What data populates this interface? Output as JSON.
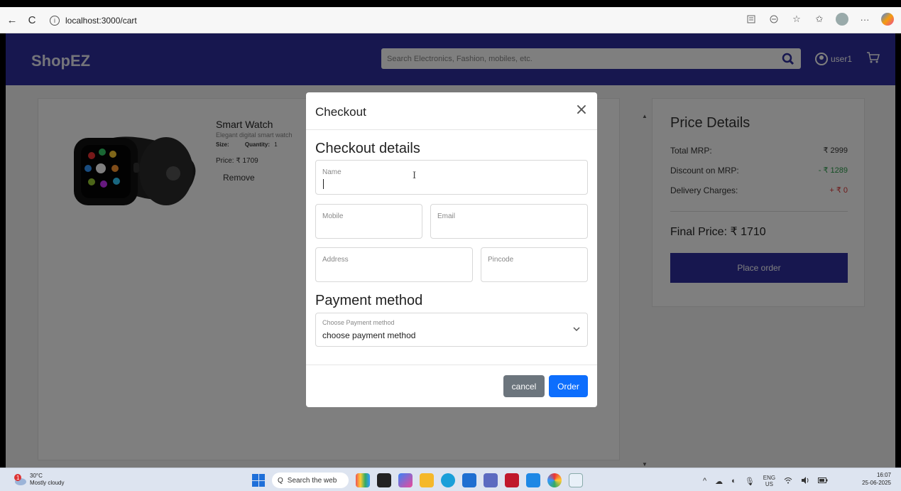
{
  "browser": {
    "url": "localhost:3000/cart",
    "back_glyph": "←",
    "reload_glyph": "C",
    "info_glyph": "i"
  },
  "header": {
    "brand": "ShopEZ",
    "search_placeholder": "Search Electronics, Fashion, mobiles, etc.",
    "user_label": "user1",
    "accent_color": "#2f2f9e"
  },
  "cart": {
    "item": {
      "title": "Smart Watch",
      "description": "Elegant digital smart watch",
      "size_label": "Size:",
      "quantity_label": "Quantity:",
      "quantity": "1",
      "price": "Price: ₹ 1709",
      "remove_label": "Remove"
    }
  },
  "price_details": {
    "title": "Price Details",
    "rows": [
      {
        "label": "Total MRP:",
        "value": "₹ 2999",
        "color": "#333333"
      },
      {
        "label": "Discount on MRP:",
        "value": "- ₹ 1289",
        "color": "#2a9d4a"
      },
      {
        "label": "Delivery Charges:",
        "value": "+ ₹ 0",
        "color": "#dd3333"
      }
    ],
    "final_price": "Final Price: ₹ 1710",
    "place_order_label": "Place order"
  },
  "modal": {
    "title": "Checkout",
    "close_glyph": "×",
    "details_title": "Checkout details",
    "fields": {
      "name": "Name",
      "mobile": "Mobile",
      "email": "Email",
      "address": "Address",
      "pincode": "Pincode"
    },
    "payment_title": "Payment method",
    "payment_label": "Choose Payment method",
    "payment_value": "choose payment method",
    "cancel_label": "cancel",
    "order_label": "Order",
    "order_color": "#0d6efd",
    "cancel_color": "#6c757d"
  },
  "taskbar": {
    "temperature": "30°C",
    "weather": "Mostly cloudy",
    "search_label": "Search the web",
    "lang_top": "ENG",
    "lang_bottom": "US",
    "time": "16:07",
    "date": "25-06-2025"
  }
}
